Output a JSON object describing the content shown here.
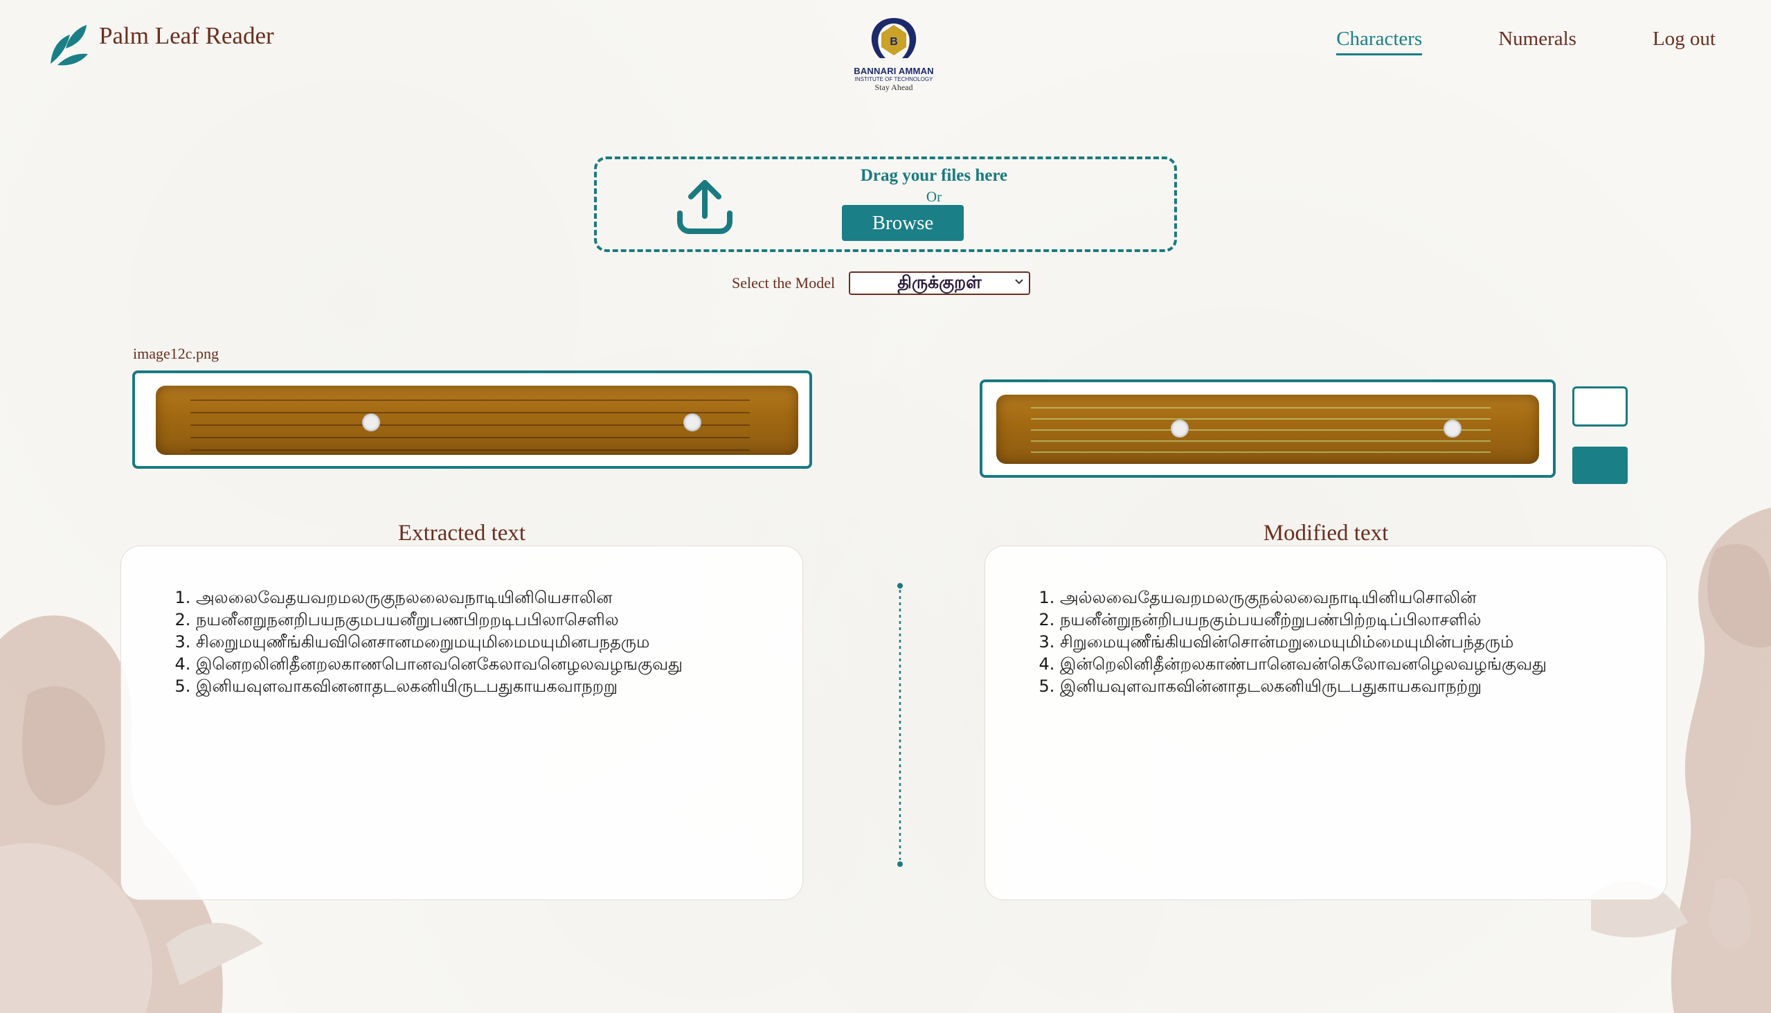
{
  "header": {
    "brand": "Palm Leaf Reader",
    "logo_name": "BANNARI AMMAN",
    "logo_sub": "INSTITUTE OF TECHNOLOGY",
    "logo_tag": "Stay Ahead",
    "nav": [
      {
        "label": "Characters",
        "active": true
      },
      {
        "label": "Numerals",
        "active": false
      },
      {
        "label": "Log out",
        "active": false
      }
    ]
  },
  "upload": {
    "title": "Drag your files here",
    "or": "Or",
    "browse_label": "Browse",
    "icon": "upload-icon"
  },
  "model": {
    "label": "Select the Model",
    "selected": "திருக்குறள்"
  },
  "images": {
    "file_name": "image12c.png"
  },
  "extracted": {
    "title": "Extracted text",
    "lines": [
      "அலலைவேதயவறமலருகுநலலைவநாடியினியெசாலின",
      "நயனீனறுநனறிபயநகுமபயனீறுபணபிறறடிபபிலாசெளில",
      "சிறைுமயுணீங்கியவினெசானமறைுமயுமிமைமயுமினபநதரும",
      "இனெறலினிதீனறலகாணபொனவனெகேலாவனெழலவழஙகுவது",
      "இனியவுளவாகவினனாதடலகனியிருடபதுகாயகவாநறறு"
    ]
  },
  "modified": {
    "title": "Modified text",
    "lines": [
      "அல்லவைதேயவறமலருகுநல்லவைநாடியினியசொலின்",
      "நயனீன்றுநன்றிபயநகும்பயனீற்றுபண்பிற்றடிப்பிலாசளில்",
      "சிறுமையுணீங்கியவின்சொன்மறுமையுமிம்மையுமின்பந்தரும்",
      "இன்றெலினிதீன்றலகாண்பானெவன்கெலோவனழெலவழங்குவது",
      "இனியவுளவாகவின்னாதடலகனியிருடபதுகாயகவாநற்று"
    ]
  },
  "colors": {
    "accent": "#1a7f86",
    "brand_text": "#6a2e1f",
    "background": "#f8f7f3"
  }
}
